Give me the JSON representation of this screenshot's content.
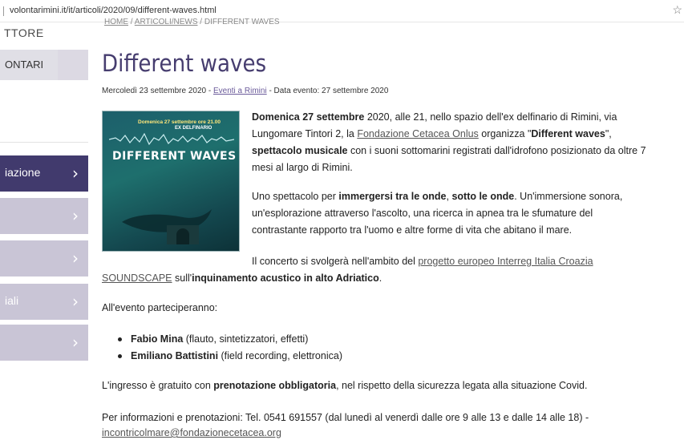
{
  "browser": {
    "url": "volontarimini.it/it/articoli/2020/09/different-waves.html"
  },
  "sidebar": {
    "top_label": "TTORE",
    "button_label": "ONTARI",
    "items": [
      {
        "label": "iazione",
        "active": true
      },
      {
        "label": "",
        "active": false
      },
      {
        "label": "",
        "active": false
      },
      {
        "label": "iali",
        "active": false
      },
      {
        "label": "",
        "active": false
      }
    ]
  },
  "breadcrumb": {
    "home": "HOME",
    "section": "ARTICOLI/NEWS",
    "current": "DIFFERENT WAVES"
  },
  "article": {
    "title": "Different waves",
    "meta": {
      "date_prefix": "Mercoledì 23 settembre 2020 - ",
      "category": "Eventi a Rimini",
      "event_date": " - Data evento: 27 settembre 2020"
    },
    "poster": {
      "top_line": "Domenica 27 settembre ore 21.00",
      "sub_line": "EX DELFINARIO",
      "title": "DIFFERENT WAVES"
    },
    "p1": {
      "bold1": "Domenica 27 settembre",
      "t1": " 2020, alle 21, nello spazio dell'ex delfinario di Rimini, via",
      "t2": "Lungomare Tintori 2, la ",
      "link": "Fondazione Cetacea Onlus",
      "t3": " organizza \"",
      "bold2": "Different waves",
      "t4": "\",",
      "bold3": "spettacolo musicale",
      "t5": " con i suoni sottomarini registrati dall'idrofono posizionato da oltre 7",
      "t6": "mesi al largo di Rimini."
    },
    "p2": {
      "t1": "Uno spettacolo per ",
      "bold1": "immergersi tra le onde",
      "t2": ", ",
      "bold2": "sotto le onde",
      "t3": ". Un'immersione sonora,",
      "line2": "un'esplorazione attraverso l'ascolto, una ricerca in apnea tra le sfumature del",
      "line3": "contrastante rapporto tra l'uomo e altre forme di vita che abitano il mare."
    },
    "p3": {
      "t1": "Il concerto si svolgerà nell'ambito del ",
      "link1": "progetto europeo Interreg Italia Croazia",
      "link2": "SOUNDSCAPE",
      "t2": " sull'",
      "bold": "inquinamento acustico in alto Adriatico",
      "t3": "."
    },
    "participants_intro": "All'evento parteciperanno:",
    "participants": [
      {
        "name": "Fabio Mina",
        "role": " (flauto, sintetizzatori, effetti)"
      },
      {
        "name": "Emiliano Battistini",
        "role": " (field recording, elettronica)"
      }
    ],
    "p4": {
      "t1": "L'ingresso è gratuito con ",
      "bold": "prenotazione obbligatoria",
      "t2": ", nel rispetto della sicurezza legata alla situazione Covid."
    },
    "p5": {
      "t1": "Per informazioni e prenotazioni: Tel. 0541 691557 (dal lunedì al venerdì dalle ore 9 alle 13 e dalle 14 alle 18) -",
      "email": "incontricolmare@fondazionecetacea.org"
    }
  },
  "colors": {
    "accent": "#463d6f",
    "menu_active": "#413a6d",
    "menu_inactive": "#c9c5d6"
  }
}
